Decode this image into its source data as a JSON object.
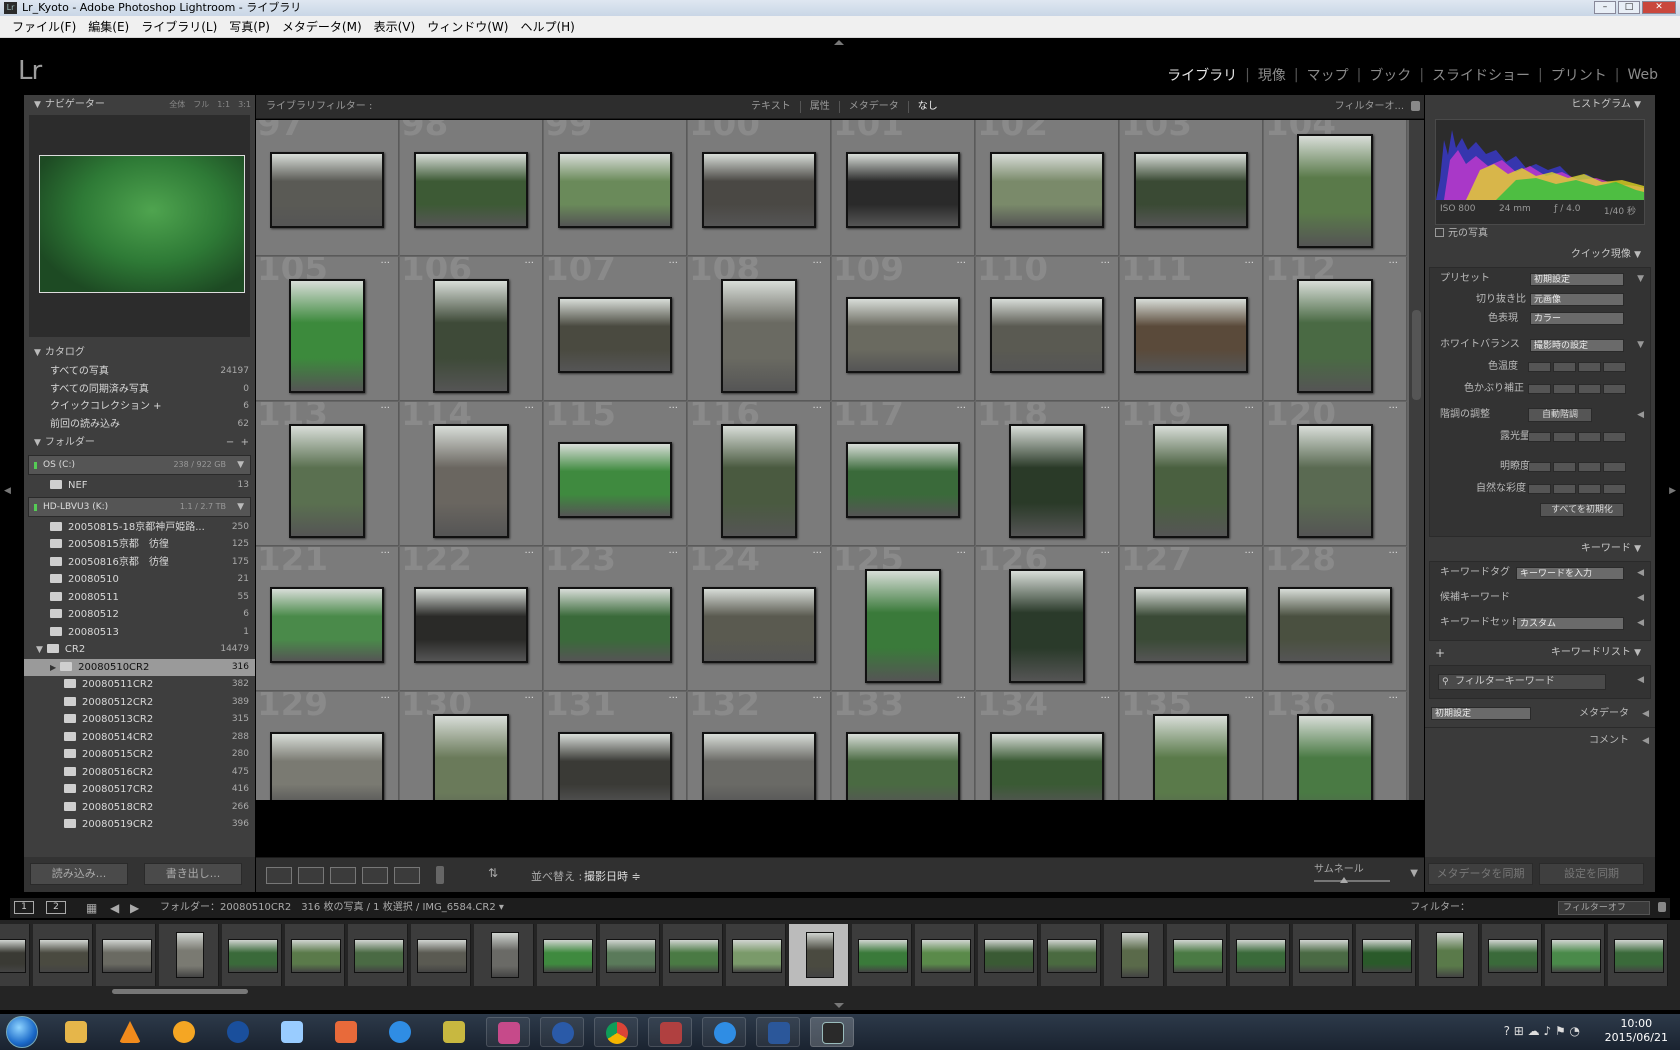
{
  "window": {
    "title": "Lr_Kyoto - Adobe Photoshop Lightroom - ライブラリ"
  },
  "menu": [
    "ファイル(F)",
    "編集(E)",
    "ライブラリ(L)",
    "写真(P)",
    "メタデータ(M)",
    "表示(V)",
    "ウィンドウ(W)",
    "ヘルプ(H)"
  ],
  "logo": "Lr",
  "modules": [
    "ライブラリ",
    "現像",
    "マップ",
    "ブック",
    "スライドショー",
    "プリント",
    "Web"
  ],
  "navigator": {
    "title": "ナビゲーター",
    "options": "全体　フル　1:1　3:1"
  },
  "catalog": {
    "title": "カタログ",
    "items": [
      {
        "label": "すべての写真",
        "count": "24197"
      },
      {
        "label": "すべての同期済み写真",
        "count": "0"
      },
      {
        "label": "クイックコレクション +",
        "count": "6"
      },
      {
        "label": "前回の読み込み",
        "count": "62"
      }
    ]
  },
  "folders": {
    "title": "フォルダー",
    "drives": [
      {
        "label": "OS (C:)",
        "size": "238 / 922 GB"
      },
      {
        "label": "HD-LBVU3 (K:)",
        "size": "1.1 / 2.7 TB"
      }
    ],
    "nef": {
      "label": "NEF",
      "count": "13"
    },
    "k_items": [
      {
        "label": "20050815-18京都神戸姫路...",
        "count": "250"
      },
      {
        "label": "20050815京都　彷徨",
        "count": "125"
      },
      {
        "label": "20050816京都　彷徨",
        "count": "175"
      },
      {
        "label": "20080510",
        "count": "21"
      },
      {
        "label": "20080511",
        "count": "55"
      },
      {
        "label": "20080512",
        "count": "6"
      },
      {
        "label": "20080513",
        "count": "1"
      },
      {
        "label": "CR2",
        "count": "14479"
      }
    ],
    "cr2_items": [
      {
        "label": "20080510CR2",
        "count": "316"
      },
      {
        "label": "20080511CR2",
        "count": "382"
      },
      {
        "label": "20080512CR2",
        "count": "389"
      },
      {
        "label": "20080513CR2",
        "count": "315"
      },
      {
        "label": "20080514CR2",
        "count": "288"
      },
      {
        "label": "20080515CR2",
        "count": "280"
      },
      {
        "label": "20080516CR2",
        "count": "475"
      },
      {
        "label": "20080517CR2",
        "count": "416"
      },
      {
        "label": "20080518CR2",
        "count": "266"
      },
      {
        "label": "20080519CR2",
        "count": "396"
      }
    ]
  },
  "left_buttons": {
    "import": "読み込み...",
    "export": "書き出し..."
  },
  "filter_bar": {
    "title": "ライブラリフィルター :",
    "options": [
      "テキスト",
      "属性",
      "メタデータ",
      "なし"
    ],
    "preset": "フィルターオ..."
  },
  "grid": {
    "cells": [
      {
        "n": "97",
        "o": "l",
        "c": "#5a5a55"
      },
      {
        "n": "98",
        "o": "l",
        "c": "#3d5a35"
      },
      {
        "n": "99",
        "o": "l",
        "c": "#6a8a5a"
      },
      {
        "n": "100",
        "o": "l",
        "c": "#4a4844"
      },
      {
        "n": "101",
        "o": "l",
        "c": "#2a2a2a"
      },
      {
        "n": "102",
        "o": "l",
        "c": "#7a8a6a"
      },
      {
        "n": "103",
        "o": "l",
        "c": "#3a4a34"
      },
      {
        "n": "104",
        "o": "p",
        "c": "#5a7a4a"
      },
      {
        "n": "105",
        "o": "p",
        "c": "#3c8a3c"
      },
      {
        "n": "106",
        "o": "p",
        "c": "#3e4a38"
      },
      {
        "n": "107",
        "o": "l",
        "c": "#4a4a40"
      },
      {
        "n": "108",
        "o": "p",
        "c": "#6a6a62"
      },
      {
        "n": "109",
        "o": "l",
        "c": "#6a6a60"
      },
      {
        "n": "110",
        "o": "l",
        "c": "#5a5a52"
      },
      {
        "n": "111",
        "o": "l",
        "c": "#5a4a3a"
      },
      {
        "n": "112",
        "o": "p",
        "c": "#4a6a44"
      },
      {
        "n": "113",
        "o": "p",
        "c": "#5a7050"
      },
      {
        "n": "114",
        "o": "p",
        "c": "#6a6660"
      },
      {
        "n": "115",
        "o": "l",
        "c": "#3f8a3f"
      },
      {
        "n": "116",
        "o": "p",
        "c": "#4a5a40"
      },
      {
        "n": "117",
        "o": "l",
        "c": "#3a6a3a"
      },
      {
        "n": "118",
        "o": "p",
        "c": "#2a3a28"
      },
      {
        "n": "119",
        "o": "p",
        "c": "#4a6040"
      },
      {
        "n": "120",
        "o": "p",
        "c": "#5a6a52"
      },
      {
        "n": "121",
        "o": "l",
        "c": "#4a8a4a"
      },
      {
        "n": "122",
        "o": "l",
        "c": "#2a2a28"
      },
      {
        "n": "123",
        "o": "l",
        "c": "#3a6a3a"
      },
      {
        "n": "124",
        "o": "l",
        "c": "#5a5a50"
      },
      {
        "n": "125",
        "o": "p",
        "c": "#3a7a3a"
      },
      {
        "n": "126",
        "o": "p",
        "c": "#2a3a2a"
      },
      {
        "n": "127",
        "o": "l",
        "c": "#3a4a36"
      },
      {
        "n": "128",
        "o": "l",
        "c": "#4a5040"
      },
      {
        "n": "129",
        "o": "l",
        "c": "#7a7a72"
      },
      {
        "n": "130",
        "o": "p",
        "c": "#6a7a5a"
      },
      {
        "n": "131",
        "o": "l",
        "c": "#3a3a36"
      },
      {
        "n": "132",
        "o": "l",
        "c": "#6a6a66"
      },
      {
        "n": "133",
        "o": "l",
        "c": "#4a6a42"
      },
      {
        "n": "134",
        "o": "l",
        "c": "#3a5a34"
      },
      {
        "n": "135",
        "o": "p",
        "c": "#5a7a4a"
      },
      {
        "n": "136",
        "o": "p",
        "c": "#4a7a44"
      }
    ],
    "cell_menu": "..."
  },
  "toolbar": {
    "sort_label": "並べ替え :",
    "sort_value": "撮影日時 ≑",
    "thumbnail_label": "サムネール"
  },
  "histogram": {
    "title": "ヒストグラム",
    "iso": "ISO 800",
    "focal": "24 mm",
    "aperture": "ƒ / 4.0",
    "shutter": "1/40 秒",
    "original": "元の写真"
  },
  "quick_develop": {
    "title": "クイック現像",
    "preset_label": "プリセット",
    "preset_value": "初期設定",
    "crop_label": "切り抜き比",
    "crop_value": "元画像",
    "treatment_label": "色表現",
    "treatment_value": "カラー",
    "wb_label": "ホワイトバランス",
    "wb_value": "撮影時の設定",
    "temp_label": "色温度",
    "tint_label": "色かぶり補正",
    "tone_label": "階調の調整",
    "tone_button": "自動階調",
    "exposure_label": "露光量",
    "clarity_label": "明瞭度",
    "vibrance_label": "自然な彩度",
    "reset_button": "すべてを初期化"
  },
  "keywording": {
    "title": "キーワード",
    "tags_label": "キーワードタグ",
    "tags_value": "キーワードを入力",
    "suggest_label": "候補キーワード",
    "set_label": "キーワードセット",
    "set_value": "カスタム"
  },
  "keyword_list": {
    "title": "キーワードリスト",
    "plus": "+",
    "filter_placeholder": "フィルターキーワード"
  },
  "metadata": {
    "preset_value": "初期設定",
    "title": "メタデータ"
  },
  "comments": {
    "title": "コメント"
  },
  "right_buttons": {
    "sync_metadata": "メタデータを同期",
    "sync_settings": "設定を同期"
  },
  "filmstrip_bar": {
    "page1": "1",
    "page2": "2",
    "info": "フォルダー：20080510CR2　316 枚の写真 / 1 枚選択 / IMG_6584.CR2 ▾",
    "filter_label": "フィルター：",
    "filter_value": "フィルターオフ"
  },
  "filmstrip": {
    "colors": [
      "#3a3a34",
      "#4a4a40",
      "#6a6a62",
      "#7a7a72",
      "#3a6a3a",
      "#5a7a4a",
      "#4a6a44",
      "#5a5a52",
      "#6a6a66",
      "#3f8a3f",
      "#5a7a5a",
      "#4a7a44",
      "#7a9a6a",
      "#4a4a40",
      "#3a7a3a",
      "#5a8a4a",
      "#3a5a34",
      "#4a6a40",
      "#5a6a4a",
      "#4a7a44",
      "#3a6a3a",
      "#4a6a44",
      "#2a5a2a",
      "#5a7a4a",
      "#3a6a3a",
      "#4a8a4a",
      "#3a6a3a"
    ],
    "selected_index": 13
  },
  "taskbar": {
    "time": "10:00",
    "date": "2015/06/21",
    "tray": "? ⊞ ☁ ♪ ⚑ ◔"
  }
}
